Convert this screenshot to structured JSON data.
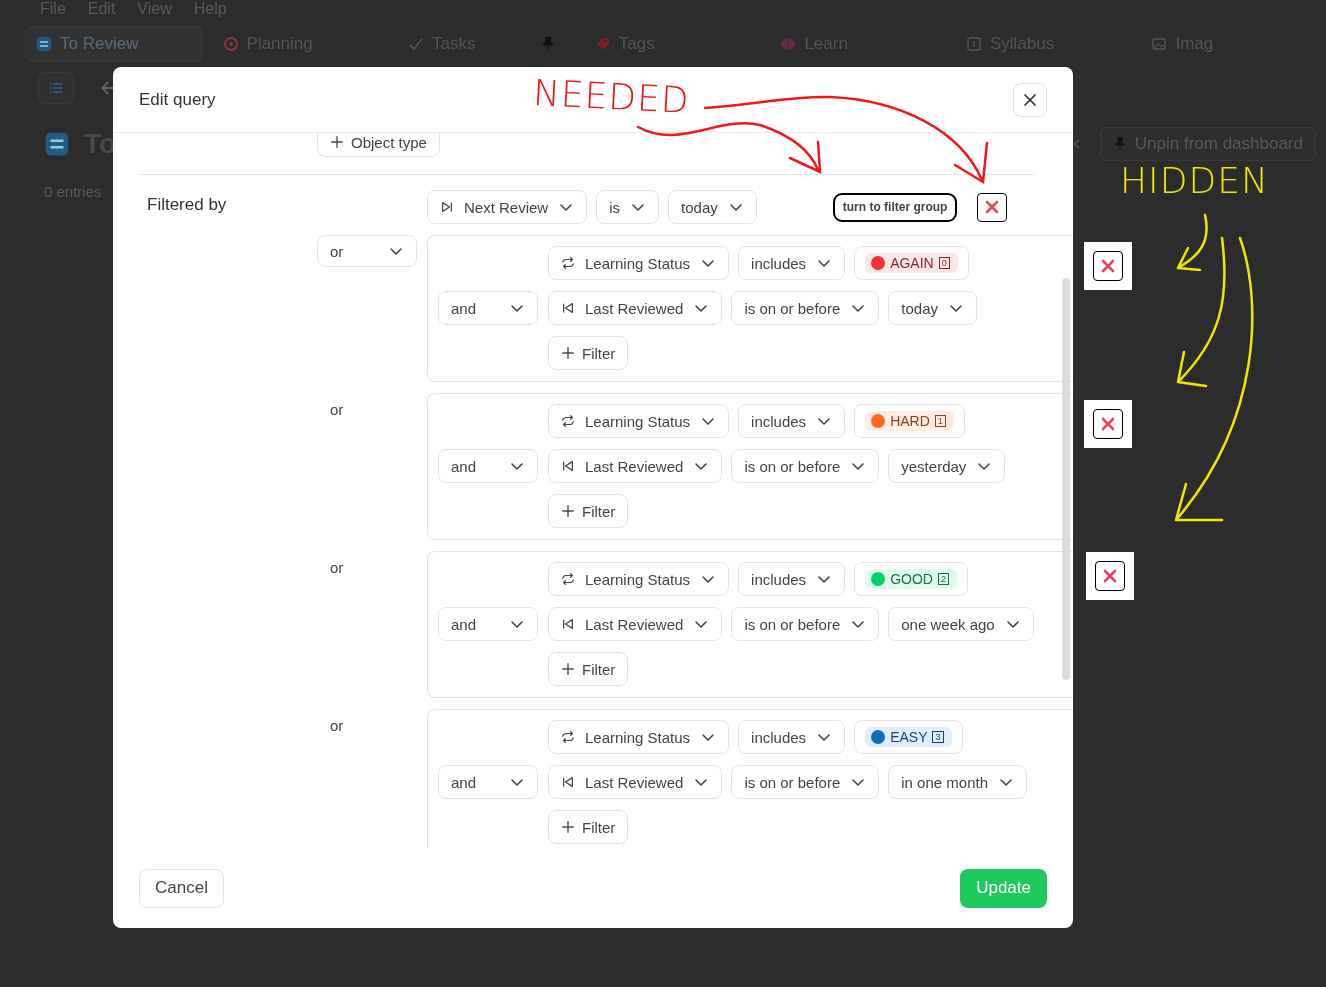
{
  "menu": [
    "File",
    "Edit",
    "View",
    "Help"
  ],
  "tabs": [
    {
      "label": "To Review",
      "kind": "text",
      "selected": true
    },
    {
      "label": "Planning",
      "kind": "text",
      "selected": false
    },
    {
      "label": "Tasks",
      "kind": "text",
      "selected": false
    },
    {
      "kind": "icon",
      "selected": false
    },
    {
      "label": "Tags",
      "kind": "text",
      "selected": false
    },
    {
      "label": "Learn",
      "kind": "text",
      "selected": false
    },
    {
      "label": "Syllabus",
      "kind": "text",
      "selected": false
    },
    {
      "label": "Imag",
      "kind": "text",
      "selected": false
    }
  ],
  "page": {
    "title": "To",
    "entries": "0 entries",
    "unpin": "Unpin from dashboard"
  },
  "dialog": {
    "title": "Edit query",
    "object_type": "Object type",
    "filtered_by": "Filtered by",
    "first_filter": {
      "field": "Next Review",
      "operator": "is",
      "value": "today"
    },
    "turn_to_group": "turn to filter group",
    "groups": [
      {
        "connector": {
          "kind": "dropdown",
          "label": "or"
        },
        "status_field": "Learning Status",
        "status_operator": "includes",
        "tag": {
          "label": "AGAIN",
          "count": "0",
          "color": "#f03232"
        },
        "joiner": "and",
        "date_field": "Last Reviewed",
        "date_operator": "is on or before",
        "date_value": "today",
        "add_filter": "Filter",
        "delete_annotated": true
      },
      {
        "connector": {
          "kind": "text",
          "label": "or"
        },
        "status_field": "Learning Status",
        "status_operator": "includes",
        "tag": {
          "label": "HARD",
          "count": "1",
          "color": "#ff6a1a"
        },
        "joiner": "and",
        "date_field": "Last Reviewed",
        "date_operator": "is on or before",
        "date_value": "yesterday",
        "add_filter": "Filter",
        "delete_annotated": true
      },
      {
        "connector": {
          "kind": "text",
          "label": "or"
        },
        "status_field": "Learning Status",
        "status_operator": "includes",
        "tag": {
          "label": "GOOD",
          "count": "2",
          "color": "#00d26a"
        },
        "joiner": "and",
        "date_field": "Last Reviewed",
        "date_operator": "is on or before",
        "date_value": "one week ago",
        "add_filter": "Filter",
        "delete_annotated": true
      },
      {
        "connector": {
          "kind": "text",
          "label": "or"
        },
        "status_field": "Learning Status",
        "status_operator": "includes",
        "tag": {
          "label": "EASY",
          "count": "3",
          "color": "#0a6fc2"
        },
        "joiner": "and",
        "date_field": "Last Reviewed",
        "date_operator": "is on or before",
        "date_value": "in one month",
        "add_filter": "Filter",
        "delete_annotated": false
      }
    ],
    "cancel": "Cancel",
    "update": "Update"
  },
  "annotations": {
    "needed": "NEEDED",
    "hidden": "HIDDEN"
  }
}
